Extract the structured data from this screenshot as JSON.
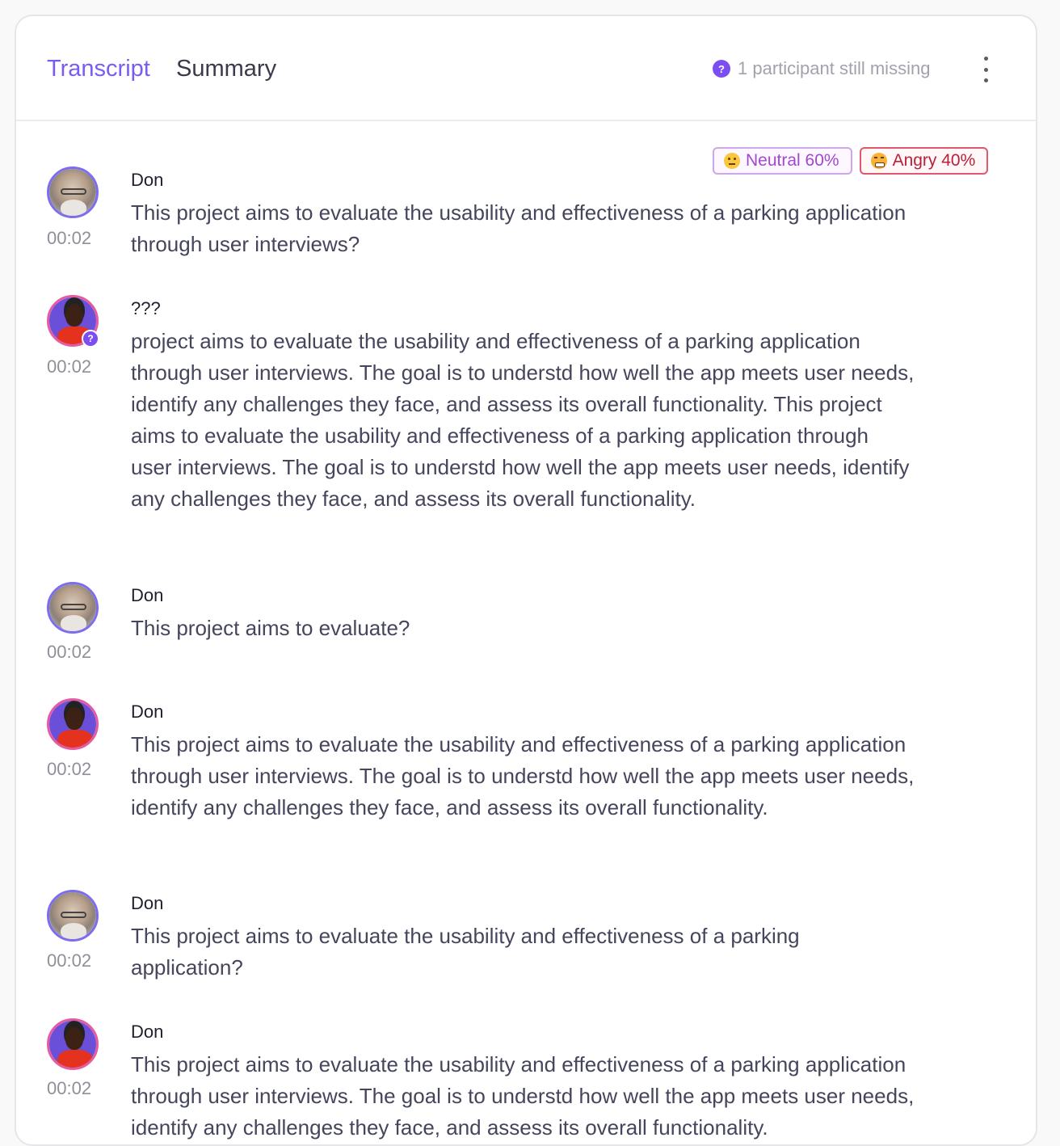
{
  "tabs": {
    "transcript": "Transcript",
    "summary": "Summary"
  },
  "status": {
    "badge": "?",
    "missing": "1 participant still missing"
  },
  "sentiments": [
    {
      "label": "Neutral 60%",
      "icon": "slightly-smiling-face-emoji",
      "color": "#a347d0"
    },
    {
      "label": "Angry 40%",
      "icon": "angry-face-emoji",
      "color": "#b9213a"
    }
  ],
  "entries": [
    {
      "speaker": "Don",
      "time": "00:02",
      "text": "This project aims to evaluate the usability and effectiveness of a parking application through user interviews?"
    },
    {
      "speaker": "???",
      "time": "00:02",
      "text": "project aims to evaluate the usability and effectiveness of a parking application through user interviews. The goal is to understd how well the app meets user needs, identify any challenges they face, and assess its overall functionality. This project aims to evaluate the usability and effectiveness of a parking application through user interviews. The goal is to understd how well the app meets user needs, identify any challenges they face, and assess its overall functionality."
    },
    {
      "speaker": "Don",
      "time": "00:02",
      "text": "This project aims to evaluate?"
    },
    {
      "speaker": "Don",
      "time": "00:02",
      "text": "This project aims to evaluate the usability and effectiveness of a parking application through user interviews. The goal is to understd how well the app meets user needs, identify any challenges they face, and assess its overall functionality."
    },
    {
      "speaker": "Don",
      "time": "00:02",
      "text": "This project aims to evaluate the usability and effectiveness of a parking application?"
    },
    {
      "speaker": "Don",
      "time": "00:02",
      "text": "This project aims to evaluate the usability and effectiveness of a parking application through user interviews. The goal is to understd how well the app meets user needs, identify any challenges they face, and assess its overall functionality."
    }
  ],
  "avatar_badge": "?",
  "colors": {
    "accent": "#7b5cf0",
    "badge": "#7c4df0"
  }
}
